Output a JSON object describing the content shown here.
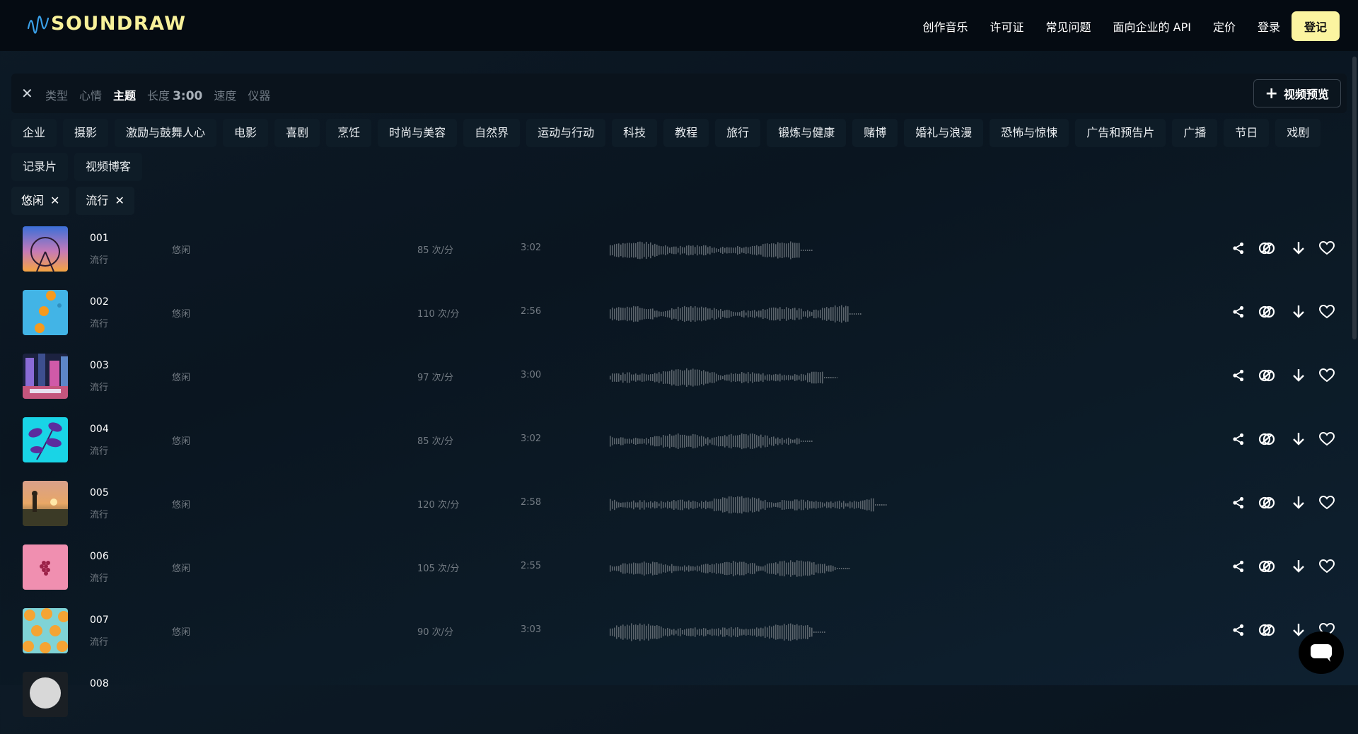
{
  "brand": {
    "name": "SOUNDRAW",
    "accent": "#f8f19a"
  },
  "nav": {
    "items": [
      "创作音乐",
      "许可证",
      "常见问题",
      "面向企业的 API",
      "定价",
      "登录"
    ],
    "signup": "登记"
  },
  "filters": {
    "close_icon": "close-icon",
    "tabs": [
      {
        "label": "类型",
        "active": false
      },
      {
        "label": "心情",
        "active": false
      },
      {
        "label": "主题",
        "active": true
      },
      {
        "label": "长度",
        "active": false,
        "value": "3:00"
      },
      {
        "label": "速度",
        "active": false
      },
      {
        "label": "仪器",
        "active": false
      }
    ],
    "video_preview": "视频预览"
  },
  "themes": [
    "企业",
    "摄影",
    "激励与鼓舞人心",
    "电影",
    "喜剧",
    "烹饪",
    "时尚与美容",
    "自然界",
    "运动与行动",
    "科技",
    "教程",
    "旅行",
    "锻炼与健康",
    "赌博",
    "婚礼与浪漫",
    "恐怖与惊悚",
    "广告和预告片",
    "广播",
    "节日",
    "戏剧",
    "记录片",
    "视频博客"
  ],
  "selected_tags": [
    "悠闲",
    "流行"
  ],
  "tracks": [
    {
      "num": "001",
      "genre": "流行",
      "mood": "悠闲",
      "bpm": "85 次/分",
      "length": "3:02",
      "cover": "ferris-wheel-sunset"
    },
    {
      "num": "002",
      "genre": "流行",
      "mood": "悠闲",
      "bpm": "110 次/分",
      "length": "2:56",
      "cover": "oranges-on-blue"
    },
    {
      "num": "003",
      "genre": "流行",
      "mood": "悠闲",
      "bpm": "97 次/分",
      "length": "3:00",
      "cover": "neon-city-street"
    },
    {
      "num": "004",
      "genre": "流行",
      "mood": "悠闲",
      "bpm": "85 次/分",
      "length": "3:02",
      "cover": "purple-leaves-cyan"
    },
    {
      "num": "005",
      "genre": "流行",
      "mood": "悠闲",
      "bpm": "120 次/分",
      "length": "2:58",
      "cover": "person-field-sunset"
    },
    {
      "num": "006",
      "genre": "流行",
      "mood": "悠闲",
      "bpm": "105 次/分",
      "length": "2:55",
      "cover": "grapes-on-pink"
    },
    {
      "num": "007",
      "genre": "流行",
      "mood": "悠闲",
      "bpm": "90 次/分",
      "length": "3:03",
      "cover": "orange-slices-pattern"
    },
    {
      "num": "008",
      "genre": "",
      "mood": "",
      "bpm": "",
      "length": "",
      "cover": "grey-sphere"
    }
  ],
  "colors": {
    "muted_text": "#737b83",
    "waveform": "#5b646c"
  }
}
